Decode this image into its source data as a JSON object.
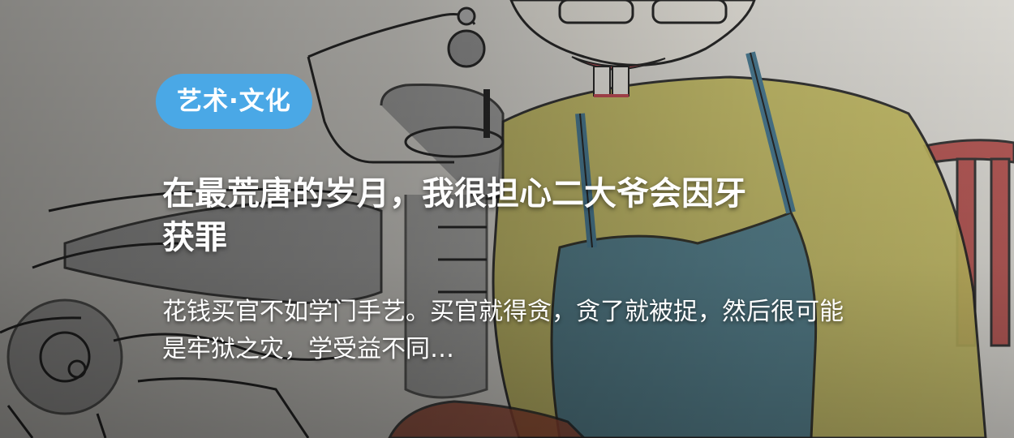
{
  "card": {
    "category": "艺术·文化",
    "title": "在最荒唐的岁月，我很担心二大爷会因牙获罪",
    "summary": "花钱买官不如学门手艺。买官就得贪，贪了就被捉，然后很可能是牢狱之灾，学受益不同…"
  },
  "colors": {
    "tag_background": "#4aa8e6",
    "text": "#ffffff",
    "paper": "#e2e0da",
    "sweater_yellow": "#c9bf62",
    "apron_blue": "#4f7f96",
    "chair_red": "#b84a4a"
  }
}
